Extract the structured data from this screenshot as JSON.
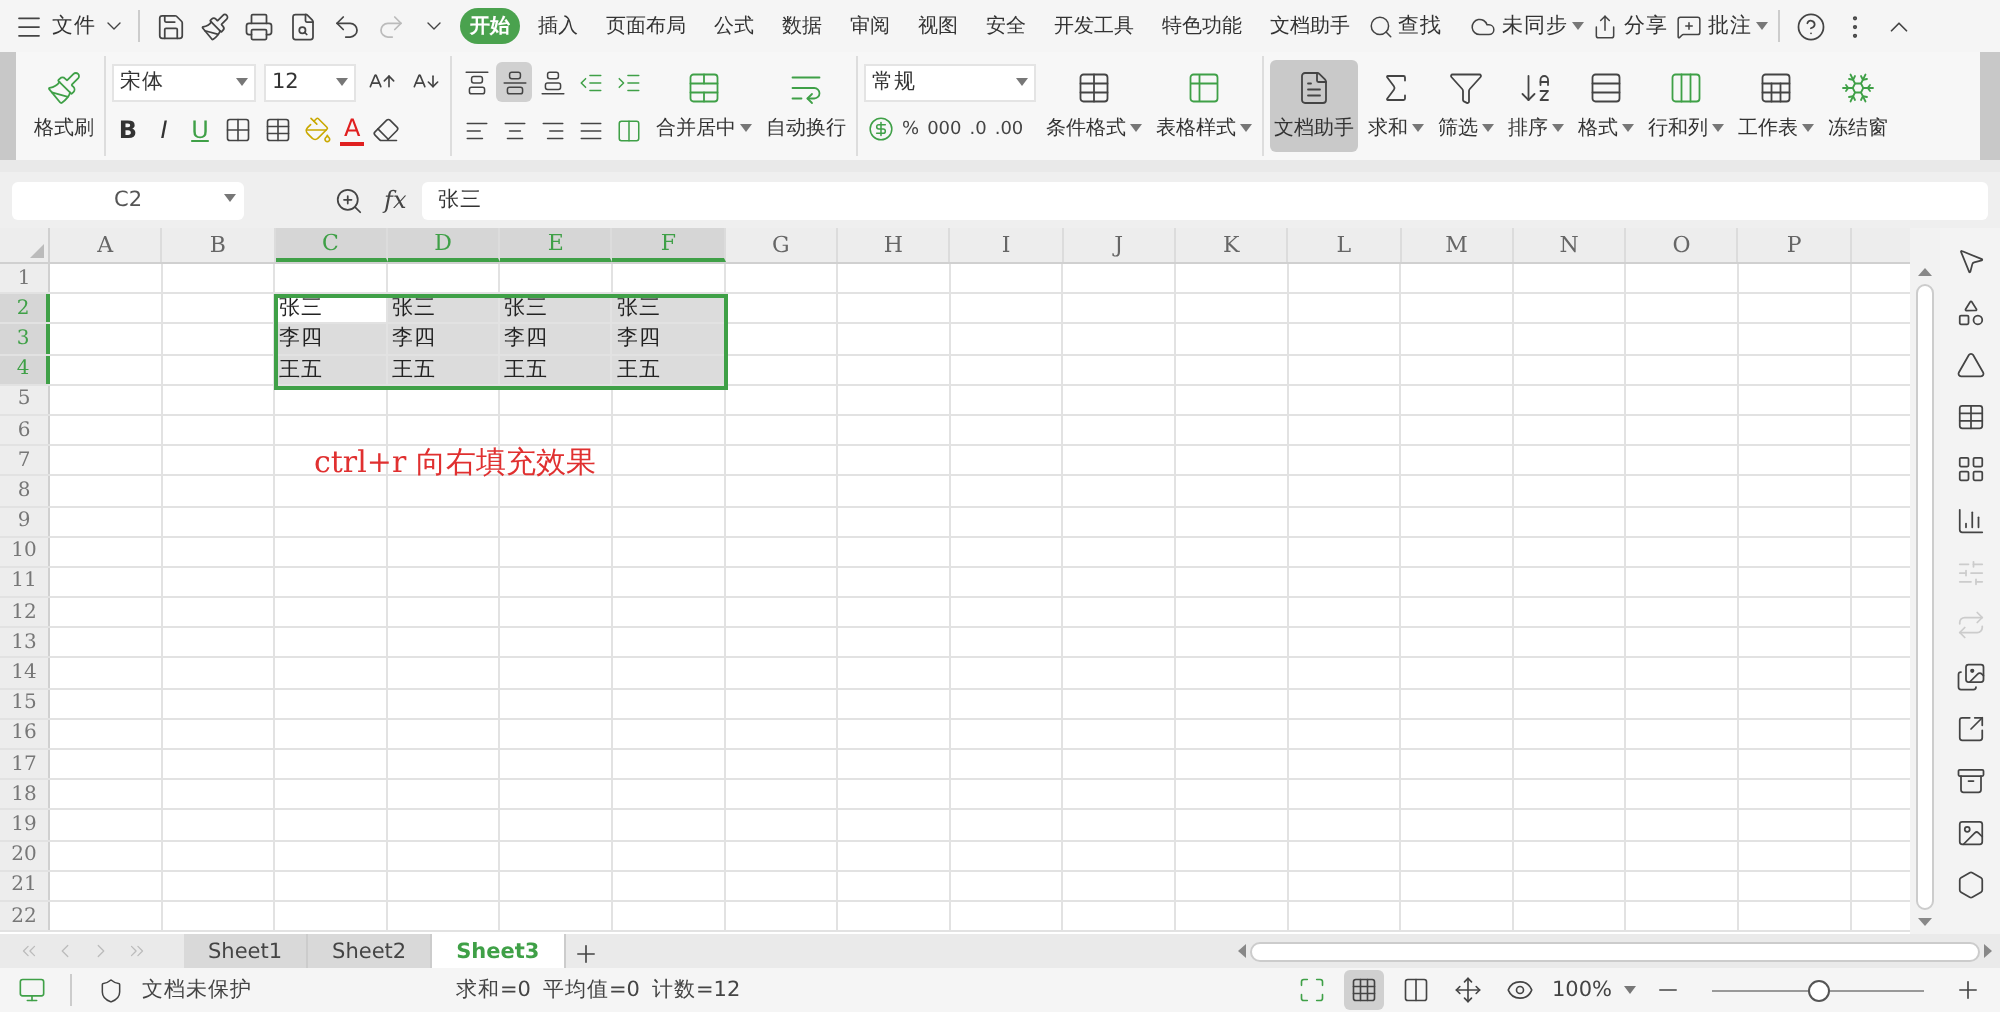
{
  "menu": {
    "file": "文件",
    "tabs": [
      {
        "label": "开始",
        "selected": true
      },
      {
        "label": "插入",
        "selected": false
      },
      {
        "label": "页面布局",
        "selected": false
      },
      {
        "label": "公式",
        "selected": false
      },
      {
        "label": "数据",
        "selected": false
      },
      {
        "label": "审阅",
        "selected": false
      },
      {
        "label": "视图",
        "selected": false
      },
      {
        "label": "安全",
        "selected": false
      },
      {
        "label": "开发工具",
        "selected": false
      },
      {
        "label": "特色功能",
        "selected": false
      },
      {
        "label": "文档助手",
        "selected": false
      }
    ],
    "search": "查找",
    "actions": [
      {
        "kind": "sync",
        "label": "未同步",
        "dropdown": true
      },
      {
        "kind": "share",
        "label": "分享",
        "dropdown": false
      },
      {
        "kind": "comment",
        "label": "批注",
        "dropdown": true
      }
    ]
  },
  "ribbon": {
    "format_painter": "格式刷",
    "font": "宋体",
    "font_size": "12",
    "style_buttons": [
      "B",
      "I",
      "U"
    ],
    "font_color": "A",
    "merge_buttons": [
      {
        "kind": "merge",
        "label": "合并居中",
        "dropdown": true
      },
      {
        "kind": "wrap",
        "label": "自动换行",
        "dropdown": false
      }
    ],
    "number_format": "常规",
    "number_buttons": [
      "%",
      "000",
      ".0",
      ".00"
    ],
    "tools": [
      {
        "kind": "conditional",
        "label": "条件格式",
        "dropdown": true,
        "selected": false
      },
      {
        "kind": "table-style",
        "label": "表格样式",
        "dropdown": true,
        "selected": false
      },
      {
        "kind": "assistant",
        "label": "文档助手",
        "dropdown": false,
        "selected": true
      },
      {
        "kind": "sum",
        "label": "求和",
        "dropdown": true,
        "selected": false
      },
      {
        "kind": "filter",
        "label": "筛选",
        "dropdown": true,
        "selected": false
      },
      {
        "kind": "sort",
        "label": "排序",
        "dropdown": true,
        "selected": false
      },
      {
        "kind": "format",
        "label": "格式",
        "dropdown": true,
        "selected": false
      },
      {
        "kind": "rowcol",
        "label": "行和列",
        "dropdown": true,
        "selected": false
      },
      {
        "kind": "sheet",
        "label": "工作表",
        "dropdown": true,
        "selected": false
      },
      {
        "kind": "freeze",
        "label": "冻结窗",
        "dropdown": false,
        "selected": false
      }
    ]
  },
  "formula_bar": {
    "name_box": "C2",
    "fx": "fx",
    "value": "张三"
  },
  "sheet": {
    "columns": [
      {
        "label": "A",
        "selected": false
      },
      {
        "label": "B",
        "selected": false
      },
      {
        "label": "C",
        "selected": true
      },
      {
        "label": "D",
        "selected": true
      },
      {
        "label": "E",
        "selected": true
      },
      {
        "label": "F",
        "selected": true
      },
      {
        "label": "G",
        "selected": false
      },
      {
        "label": "H",
        "selected": false
      },
      {
        "label": "I",
        "selected": false
      },
      {
        "label": "J",
        "selected": false
      },
      {
        "label": "K",
        "selected": false
      },
      {
        "label": "L",
        "selected": false
      },
      {
        "label": "M",
        "selected": false
      },
      {
        "label": "N",
        "selected": false
      },
      {
        "label": "O",
        "selected": false
      },
      {
        "label": "P",
        "selected": false
      }
    ],
    "rows": [
      {
        "label": "1",
        "selected": false,
        "cells": []
      },
      {
        "label": "2",
        "selected": true,
        "cells": [
          null,
          null,
          {
            "text": "张三",
            "active": true
          },
          {
            "text": "张三",
            "active": false
          },
          {
            "text": "张三",
            "active": false
          },
          {
            "text": "张三",
            "active": false
          }
        ]
      },
      {
        "label": "3",
        "selected": true,
        "cells": [
          null,
          null,
          {
            "text": "李四",
            "active": false
          },
          {
            "text": "李四",
            "active": false
          },
          {
            "text": "李四",
            "active": false
          },
          {
            "text": "李四",
            "active": false
          }
        ]
      },
      {
        "label": "4",
        "selected": true,
        "cells": [
          null,
          null,
          {
            "text": "王五",
            "active": false
          },
          {
            "text": "王五",
            "active": false
          },
          {
            "text": "王五",
            "active": false
          },
          {
            "text": "王五",
            "active": false
          }
        ]
      },
      {
        "label": "5",
        "selected": false,
        "cells": []
      },
      {
        "label": "6",
        "selected": false,
        "cells": []
      },
      {
        "label": "7",
        "selected": false,
        "cells": []
      },
      {
        "label": "8",
        "selected": false,
        "cells": []
      },
      {
        "label": "9",
        "selected": false,
        "cells": []
      },
      {
        "label": "10",
        "selected": false,
        "cells": []
      },
      {
        "label": "11",
        "selected": false,
        "cells": []
      },
      {
        "label": "12",
        "selected": false,
        "cells": []
      },
      {
        "label": "13",
        "selected": false,
        "cells": []
      },
      {
        "label": "14",
        "selected": false,
        "cells": []
      },
      {
        "label": "15",
        "selected": false,
        "cells": []
      },
      {
        "label": "16",
        "selected": false,
        "cells": []
      },
      {
        "label": "17",
        "selected": false,
        "cells": []
      },
      {
        "label": "18",
        "selected": false,
        "cells": []
      },
      {
        "label": "19",
        "selected": false,
        "cells": []
      },
      {
        "label": "20",
        "selected": false,
        "cells": []
      },
      {
        "label": "21",
        "selected": false,
        "cells": []
      },
      {
        "label": "22",
        "selected": false,
        "cells": []
      }
    ],
    "annotation": "ctrl+r 向右填充效果"
  },
  "sheet_tabs": [
    {
      "label": "Sheet1",
      "selected": false
    },
    {
      "label": "Sheet2",
      "selected": false
    },
    {
      "label": "Sheet3",
      "selected": true
    }
  ],
  "status_bar": {
    "protection": "文档未保护",
    "stats": [
      "求和=0",
      "平均值=0",
      "计数=12"
    ],
    "zoom": "100%",
    "zoom_slider": {
      "level": 0.5
    }
  }
}
